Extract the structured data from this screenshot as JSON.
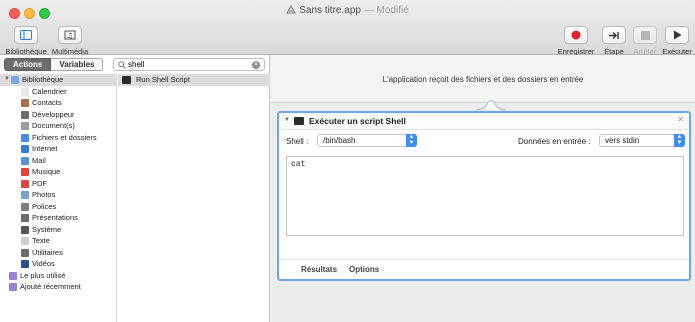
{
  "window": {
    "title": "Sans titre.app",
    "separator": "—",
    "status": "Modifié"
  },
  "toolbar": {
    "left": [
      {
        "label": "Bibliothèque",
        "icon": "library-panel-icon"
      },
      {
        "label": "Multimédia",
        "icon": "media-icon"
      }
    ],
    "right": [
      {
        "label": "Enregistrer",
        "icon": "record-icon",
        "enabled": true
      },
      {
        "label": "Étape",
        "icon": "step-icon",
        "enabled": true
      },
      {
        "label": "Arrêter",
        "icon": "stop-icon",
        "enabled": false
      },
      {
        "label": "Exécuter",
        "icon": "run-icon",
        "enabled": true
      }
    ]
  },
  "sidebar": {
    "segments": [
      "Actions",
      "Variables"
    ],
    "active_segment": "Actions",
    "search": {
      "value": "shell",
      "placeholder": ""
    },
    "library": {
      "header": "Bibliothèque",
      "items": [
        {
          "label": "Calendrier",
          "color": "#e9e9e9"
        },
        {
          "label": "Contacts",
          "color": "#a8714a"
        },
        {
          "label": "Développeur",
          "color": "#6b6b6b"
        },
        {
          "label": "Document(s)",
          "color": "#9c9c9c"
        },
        {
          "label": "Fichiers et dossiers",
          "color": "#4b8fe0"
        },
        {
          "label": "Internet",
          "color": "#3a7cd6"
        },
        {
          "label": "Mail",
          "color": "#5a93d8"
        },
        {
          "label": "Musique",
          "color": "#e6433e"
        },
        {
          "label": "PDF",
          "color": "#d84b3e"
        },
        {
          "label": "Photos",
          "color": "#7aa0c8"
        },
        {
          "label": "Polices",
          "color": "#7e7e7e"
        },
        {
          "label": "Présentations",
          "color": "#6b6b6b"
        },
        {
          "label": "Système",
          "color": "#555555"
        },
        {
          "label": "Texte",
          "color": "#cfcfcf"
        },
        {
          "label": "Utilitaires",
          "color": "#6b6b6b"
        },
        {
          "label": "Vidéos",
          "color": "#2b4e8f"
        }
      ],
      "footer_items": [
        {
          "label": "Le plus utilisé",
          "color": "#9a7fd3"
        },
        {
          "label": "Ajouté récemment",
          "color": "#9a7fd3"
        }
      ]
    },
    "actions": [
      {
        "label": "Run Shell Script"
      }
    ]
  },
  "workflow": {
    "input_description": "L'application reçoit des fichiers et des dossiers en entrée",
    "action": {
      "title": "Exécuter un script Shell",
      "shell_label": "Shell :",
      "shell_value": "/bin/bash",
      "input_label": "Données en entrée :",
      "input_value": "vers stdin",
      "script": "cat",
      "tabs": [
        "Résultats",
        "Options"
      ]
    }
  }
}
